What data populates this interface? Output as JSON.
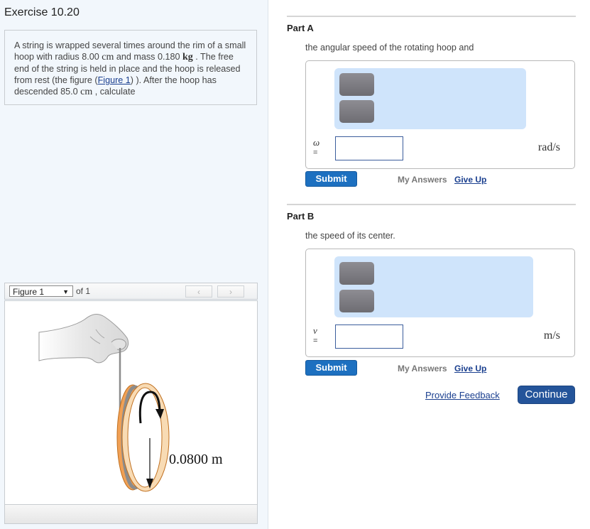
{
  "exercise": {
    "title": "Exercise 10.20",
    "problem": {
      "t1": "A string is wrapped several times around the rim of a small hoop with radius ",
      "radius_value": "8.00",
      "radius_unit": "cm",
      "t2": " and mass ",
      "mass_value": "0.180",
      "mass_unit": "kg",
      "t3": " . The free end of the string is held in place and the hoop is released from rest (the figure (",
      "figure_link": "Figure 1",
      "t4": ") ). After the hoop has descended ",
      "descent_value": "85.0",
      "descent_unit": "cm",
      "t5": " , calculate"
    }
  },
  "figure_viewer": {
    "selected": "Figure 1",
    "of_label": "of 1",
    "prev_icon": "‹",
    "next_icon": "›",
    "figure_label": "0.0800 m"
  },
  "parts": [
    {
      "title": "Part A",
      "question": "the angular speed of the rotating hoop and",
      "variable": "ω",
      "equals": "=",
      "value": "",
      "unit": "rad/s",
      "submit_label": "Submit",
      "my_answers_label": "My Answers",
      "give_up_label": "Give Up"
    },
    {
      "title": "Part B",
      "question": "the speed of its center.",
      "variable": "v",
      "equals": "=",
      "value": "",
      "unit": "m/s",
      "submit_label": "Submit",
      "my_answers_label": "My Answers",
      "give_up_label": "Give Up"
    }
  ],
  "footer": {
    "feedback_label": "Provide Feedback",
    "continue_label": "Continue"
  }
}
